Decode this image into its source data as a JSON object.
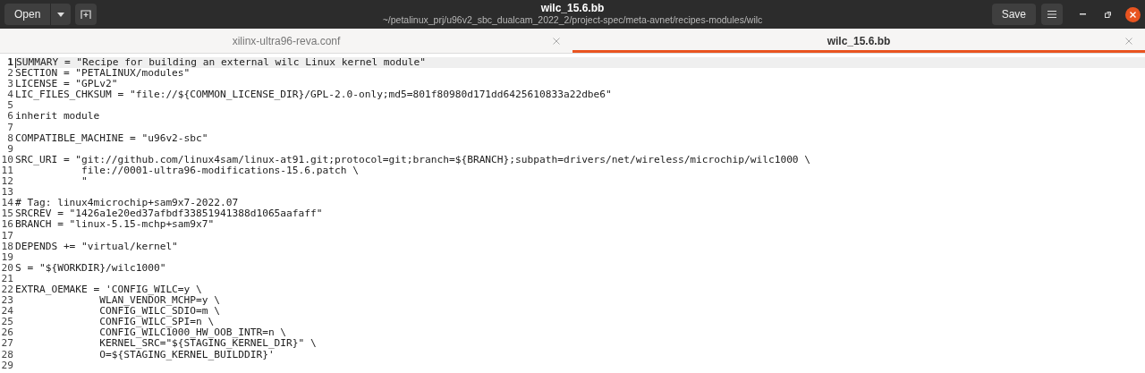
{
  "header": {
    "open_button": "Open",
    "title": "wilc_15.6.bb",
    "subtitle": "~/petalinux_prj/u96v2_sbc_dualcam_2022_2/project-spec/meta-avnet/recipes-modules/wilc",
    "save_button": "Save"
  },
  "tabs": [
    {
      "label": "xilinx-ultra96-reva.conf",
      "selected": false
    },
    {
      "label": "wilc_15.6.bb",
      "selected": true
    }
  ],
  "editor": {
    "lines": [
      {
        "number": "1",
        "text": "SUMMARY = \"Recipe for building an external wilc Linux kernel module\"",
        "current": true
      },
      {
        "number": "2",
        "text": "SECTION = \"PETALINUX/modules\"",
        "current": false
      },
      {
        "number": "3",
        "text": "LICENSE = \"GPLv2\"",
        "current": false
      },
      {
        "number": "4",
        "text": "LIC_FILES_CHKSUM = \"file://${COMMON_LICENSE_DIR}/GPL-2.0-only;md5=801f80980d171dd6425610833a22dbe6\"",
        "current": false
      },
      {
        "number": "5",
        "current": false
      },
      {
        "number": "6",
        "text": "inherit module",
        "current": false
      },
      {
        "number": "7",
        "current": false
      },
      {
        "number": "8",
        "text": "COMPATIBLE_MACHINE = \"u96v2-sbc\"",
        "current": false
      },
      {
        "number": "9",
        "current": false
      },
      {
        "number": "10",
        "text": "SRC_URI = \"git://github.com/linux4sam/linux-at91.git;protocol=git;branch=${BRANCH};subpath=drivers/net/wireless/microchip/wilc1000 \\",
        "current": false
      },
      {
        "number": "11",
        "text": "           file://0001-ultra96-modifications-15.6.patch \\",
        "current": false
      },
      {
        "number": "12",
        "text": "           \"",
        "current": false
      },
      {
        "number": "13",
        "current": false
      },
      {
        "number": "14",
        "text": "# Tag: linux4microchip+sam9x7-2022.07",
        "current": false
      },
      {
        "number": "15",
        "text": "SRCREV = \"1426a1e20ed37afbdf33851941388d1065aafaff\"",
        "current": false
      },
      {
        "number": "16",
        "text": "BRANCH = \"linux-5.15-mchp+sam9x7\"",
        "current": false
      },
      {
        "number": "17",
        "current": false
      },
      {
        "number": "18",
        "text": "DEPENDS += \"virtual/kernel\"",
        "current": false
      },
      {
        "number": "19",
        "current": false
      },
      {
        "number": "20",
        "text": "S = \"${WORKDIR}/wilc1000\"",
        "current": false
      },
      {
        "number": "21",
        "current": false
      },
      {
        "number": "22",
        "text": "EXTRA_OEMAKE = 'CONFIG_WILC=y \\",
        "current": false
      },
      {
        "number": "23",
        "text": "              WLAN_VENDOR_MCHP=y \\",
        "current": false
      },
      {
        "number": "24",
        "text": "              CONFIG_WILC_SDIO=m \\",
        "current": false
      },
      {
        "number": "25",
        "text": "              CONFIG_WILC_SPI=n \\",
        "current": false
      },
      {
        "number": "26",
        "text": "              CONFIG_WILC1000_HW_OOB_INTR=n \\",
        "current": false
      },
      {
        "number": "27",
        "text": "              KERNEL_SRC=\"${STAGING_KERNEL_DIR}\" \\",
        "current": false
      },
      {
        "number": "28",
        "text": "              O=${STAGING_KERNEL_BUILDDIR}'",
        "current": false
      },
      {
        "number": "29",
        "current": false
      }
    ]
  }
}
